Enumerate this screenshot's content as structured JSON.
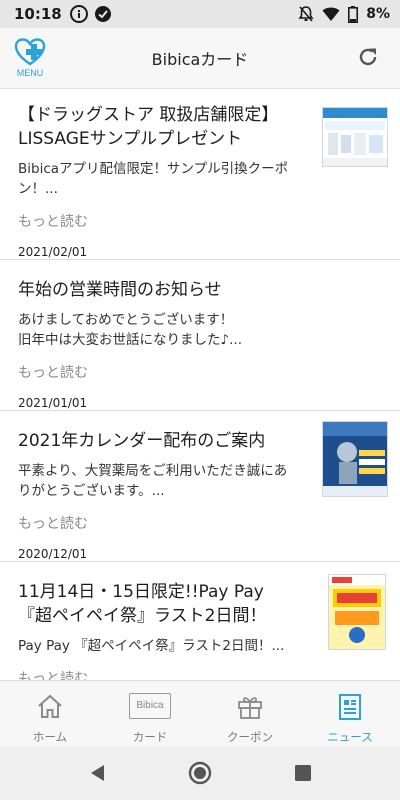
{
  "status_bar": {
    "time": "10:18",
    "battery": "8%"
  },
  "header": {
    "menu_label": "MENU",
    "title": "Bibicaカード"
  },
  "news": [
    {
      "title": "【ドラッグストア 取扱店舗限定】LISSAGEサンプルプレゼント",
      "body": "Bibicaアプリ配信限定！サンプル引換クーポン！...",
      "more": "もっと読む",
      "date": "2021/02/01",
      "has_thumb": true
    },
    {
      "title": "年始の営業時間のお知らせ",
      "body": "あけましておめでとうございます！\n旧年中は大変お世話になりました♪...",
      "more": "もっと読む",
      "date": "2021/01/01",
      "has_thumb": false
    },
    {
      "title": "2021年カレンダー配布のご案内",
      "body": "平素より、大賀薬局をご利用いただき誠にありがとうございます。...",
      "more": "もっと読む",
      "date": "2020/12/01",
      "has_thumb": true
    },
    {
      "title": "11月14日・15日限定!!Pay Pay 『超ペイペイ祭』ラスト2日間！",
      "body": "Pay Pay 『超ペイペイ祭』ラスト2日間！...",
      "more": "もっと読む",
      "date": "",
      "has_thumb": true
    }
  ],
  "bottom_nav": {
    "tabs": [
      {
        "label": "ホーム",
        "icon": "home-icon"
      },
      {
        "label": "カード",
        "icon": "card-icon",
        "icon_text": "Bibica"
      },
      {
        "label": "クーポン",
        "icon": "gift-icon"
      },
      {
        "label": "ニュース",
        "icon": "news-icon",
        "active": true
      }
    ]
  },
  "colors": {
    "accent": "#29a3d9",
    "status_bar_bg": "#e6e6e6",
    "header_bg": "#f7f7f7"
  }
}
